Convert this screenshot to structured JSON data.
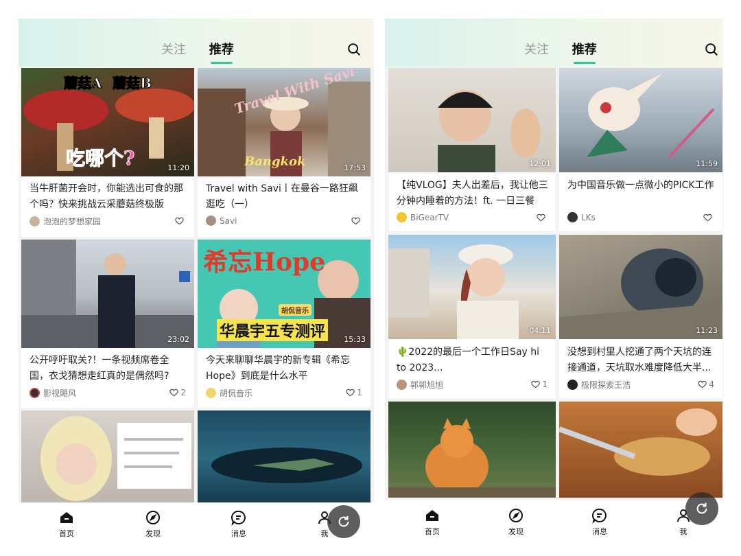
{
  "left": {
    "tabs": [
      {
        "label": "关注"
      },
      {
        "label": "推荐"
      }
    ],
    "cards": [
      {
        "title": "当牛肝菌开会时，你能选出可食的那个吗？快来挑战云采蘑菇终极版",
        "author": "泡泡的梦想家园",
        "duration": "11:20",
        "likes": "",
        "overlay": [
          "蘑菇A",
          "蘑菇B",
          "吃哪个?"
        ]
      },
      {
        "title": "Travel with Savi丨在曼谷一路狂飙逛吃（一）",
        "author": "Savi",
        "duration": "17:53",
        "likes": "",
        "overlay": [
          "Travel With Savi",
          "Bangkok"
        ]
      },
      {
        "title": "公开呼吁取关?！一条视频席卷全国，衣戈猜想走红真的是偶然吗?",
        "author": "影视飓风",
        "duration": "23:02",
        "likes": "2",
        "overlay": []
      },
      {
        "title": "今天来聊聊华晨宇的新专辑《希忘Hope》到底是什么水平",
        "author": "胡侃音乐",
        "duration": "15:33",
        "likes": "1",
        "overlay": [
          "希忘Hope",
          "胡侃音乐",
          "华晨宇五专测评"
        ]
      },
      {
        "title": "",
        "author": "",
        "duration": "",
        "likes": "",
        "overlay": []
      },
      {
        "title": "",
        "author": "",
        "duration": "",
        "likes": "",
        "overlay": []
      }
    ],
    "nav": [
      {
        "label": "首页"
      },
      {
        "label": "发现"
      },
      {
        "label": "消息"
      },
      {
        "label": "我"
      }
    ]
  },
  "right": {
    "tabs": [
      {
        "label": "关注"
      },
      {
        "label": "推荐"
      }
    ],
    "cards": [
      {
        "title": "【纯VLOG】夫人出差后，我让他三分钟内睡着的方法！ft. 一日三餐",
        "author": "BiGearTV",
        "duration": "12:01",
        "likes": ""
      },
      {
        "title": "为中国音乐做一点微小的PICK工作",
        "author": "LKs",
        "duration": "11:59",
        "likes": ""
      },
      {
        "title": "🌵2022的最后一个工作日Say hi to 2023...",
        "author": "郭郭旭旭",
        "duration": "04:11",
        "likes": "1"
      },
      {
        "title": "没想到村里人挖通了两个天坑的连接通道，天坑取水难度降低大半...",
        "author": "极限探索王浩",
        "duration": "11:23",
        "likes": "4"
      },
      {
        "title": "",
        "author": "",
        "duration": "",
        "likes": ""
      },
      {
        "title": "",
        "author": "",
        "duration": "",
        "likes": ""
      }
    ],
    "nav": [
      {
        "label": "首页"
      },
      {
        "label": "发现"
      },
      {
        "label": "消息"
      },
      {
        "label": "我"
      }
    ]
  },
  "colors": {
    "accent": "#35c7a3",
    "text": "#222222",
    "muted": "#777777",
    "header_gradient_start": "#d9f1ec"
  }
}
